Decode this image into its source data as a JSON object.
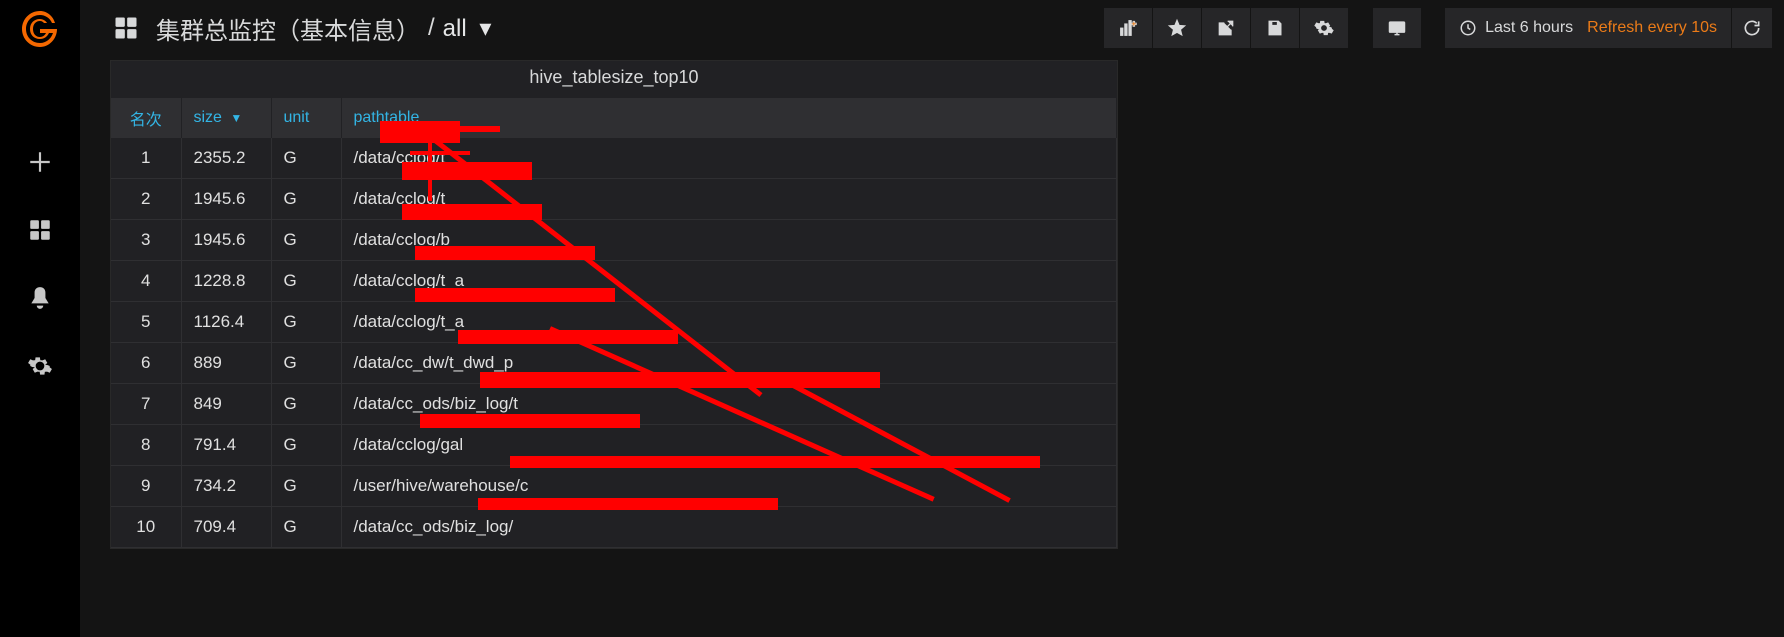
{
  "header": {
    "dashboard_title": "集群总监控（基本信息）",
    "separator": "/",
    "variable_value": "all",
    "time_range": "Last 6 hours",
    "refresh_label": "Refresh every 10s"
  },
  "panel": {
    "title": "hive_tablesize_top10",
    "columns": {
      "rank": "名次",
      "size": "size",
      "unit": "unit",
      "pathtable": "pathtable"
    },
    "sort_indicator": "▼",
    "rows": [
      {
        "rank": "1",
        "size": "2355.2",
        "unit": "G",
        "path": "/data/cclog/t_"
      },
      {
        "rank": "2",
        "size": "1945.6",
        "unit": "G",
        "path": "/data/cclog/t_"
      },
      {
        "rank": "3",
        "size": "1945.6",
        "unit": "G",
        "path": "/data/cclog/b"
      },
      {
        "rank": "4",
        "size": "1228.8",
        "unit": "G",
        "path": "/data/cclog/t_a"
      },
      {
        "rank": "5",
        "size": "1126.4",
        "unit": "G",
        "path": "/data/cclog/t_a"
      },
      {
        "rank": "6",
        "size": "889",
        "unit": "G",
        "path": "/data/cc_dw/t_dwd_p"
      },
      {
        "rank": "7",
        "size": "849",
        "unit": "G",
        "path": "/data/cc_ods/biz_log/t"
      },
      {
        "rank": "8",
        "size": "791.4",
        "unit": "G",
        "path": "/data/cclog/gal"
      },
      {
        "rank": "9",
        "size": "734.2",
        "unit": "G",
        "path": "/user/hive/warehouse/c"
      },
      {
        "rank": "10",
        "size": "709.4",
        "unit": "G",
        "path": "/data/cc_ods/biz_log/"
      }
    ]
  }
}
